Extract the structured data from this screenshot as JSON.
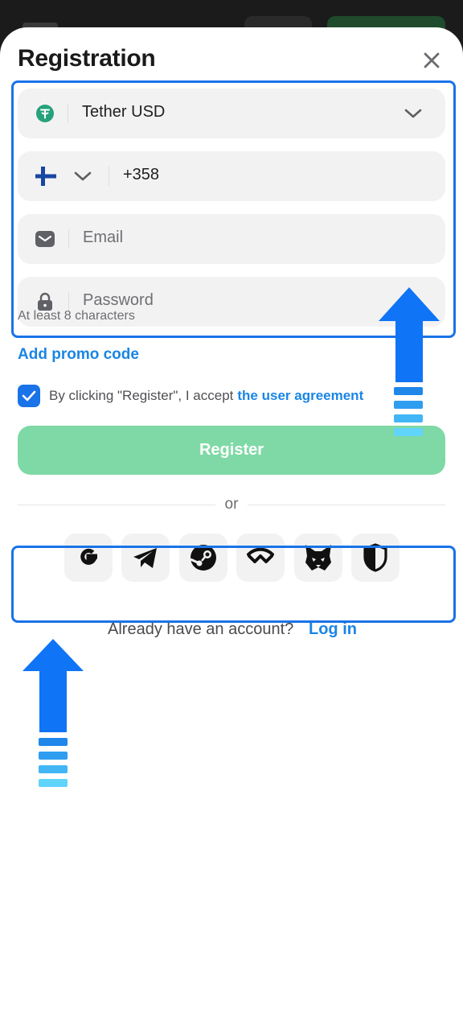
{
  "modal": {
    "title": "Registration"
  },
  "currency": {
    "value": "Tether USD",
    "icon": "tether-icon"
  },
  "phone": {
    "code": "+358",
    "flag": "finland-flag-icon"
  },
  "email": {
    "placeholder": "Email"
  },
  "password": {
    "placeholder": "Password",
    "hint": "At least 8 characters"
  },
  "promo": {
    "label": "Add promo code"
  },
  "agreement": {
    "text": "By clicking \"Register\", I accept",
    "link": "the user agreement",
    "checked": true
  },
  "register": {
    "label": "Register"
  },
  "divider": {
    "label": "or"
  },
  "social": [
    {
      "name": "google-icon"
    },
    {
      "name": "telegram-icon"
    },
    {
      "name": "steam-icon"
    },
    {
      "name": "walletconnect-icon"
    },
    {
      "name": "metamask-fox-icon"
    },
    {
      "name": "shield-icon"
    }
  ],
  "footer": {
    "text": "Already have an account?",
    "link": "Log in"
  },
  "colors": {
    "accent": "#1a85e5",
    "register_bg": "#7fd9a6",
    "highlight": "#1a73e8",
    "field_bg": "#f2f2f3"
  }
}
